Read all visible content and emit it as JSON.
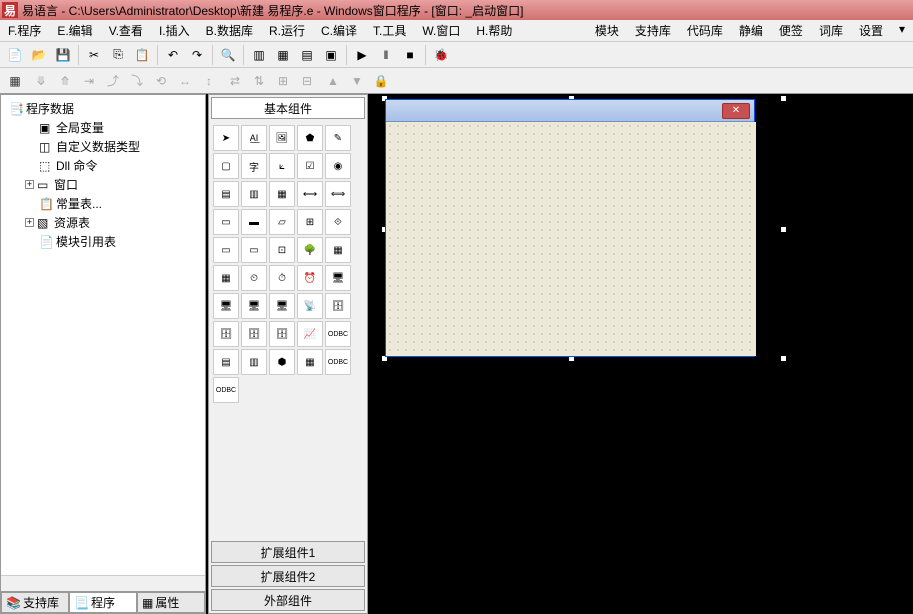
{
  "title": "易语言 - C:\\Users\\Administrator\\Desktop\\新建 易程序.e - Windows窗口程序 - [窗口: _启动窗口]",
  "menu": {
    "items": [
      "F.程序",
      "E.编辑",
      "V.查看",
      "I.插入",
      "B.数据库",
      "R.运行",
      "C.编译",
      "T.工具",
      "W.窗口",
      "H.帮助"
    ],
    "right": [
      "模块",
      "支持库",
      "代码库",
      "静编",
      "便签",
      "词库",
      "设置"
    ]
  },
  "tree": {
    "root": "程序数据",
    "items": [
      "全局变量",
      "自定义数据类型",
      "Dll 命令",
      "窗口",
      "常量表...",
      "资源表",
      "模块引用表"
    ]
  },
  "leftTabs": [
    "支持库",
    "程序",
    "属性"
  ],
  "componentTabs": {
    "main": "基本组件",
    "ext1": "扩展组件1",
    "ext2": "扩展组件2",
    "ext3": "外部组件"
  },
  "toolbarIcons": [
    "new",
    "open",
    "save",
    "cut",
    "copy",
    "paste",
    "undo",
    "redo",
    "find",
    "layout1",
    "layout2",
    "layout3",
    "layout4",
    "run",
    "step",
    "stop",
    "debug"
  ],
  "componentIcons": [
    "pointer",
    "label",
    "image",
    "shape",
    "draw",
    "frame",
    "text",
    "line",
    "check",
    "radio",
    "list",
    "combo",
    "edit",
    "hscroll",
    "vscroll",
    "group1",
    "group2",
    "progress",
    "tab",
    "slider",
    "panel",
    "date",
    "calendar",
    "tree",
    "grid",
    "rich",
    "timer",
    "time",
    "clock",
    "sock1",
    "sock2",
    "sock3",
    "sock4",
    "net",
    "db1",
    "db2",
    "db3",
    "db4",
    "link",
    "odbc1",
    "report",
    "chart",
    "icon",
    "col",
    "odbc2",
    "odbc3"
  ]
}
